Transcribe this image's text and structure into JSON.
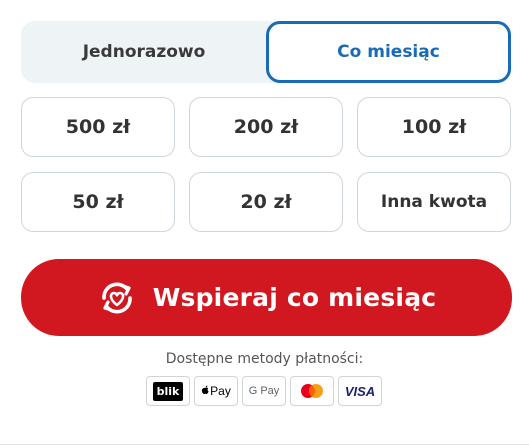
{
  "frequency": {
    "options": [
      "Jednorazowo",
      "Co miesiąc"
    ],
    "selected": "Co miesiąc"
  },
  "amounts": [
    "500 zł",
    "200 zł",
    "100 zł",
    "50 zł",
    "20 zł",
    "Inna kwota"
  ],
  "cta": {
    "label": "Wspieraj co miesiąc",
    "icon": "heart-cycle-icon"
  },
  "payment": {
    "label": "Dostępne metody płatności:",
    "methods": [
      "blik",
      "Pay",
      "G Pay",
      "mastercard",
      "VISA"
    ]
  },
  "colors": {
    "accent_blue": "#1a6bb5",
    "cta_red": "#d1171f",
    "toggle_bg": "#eef3f6"
  }
}
